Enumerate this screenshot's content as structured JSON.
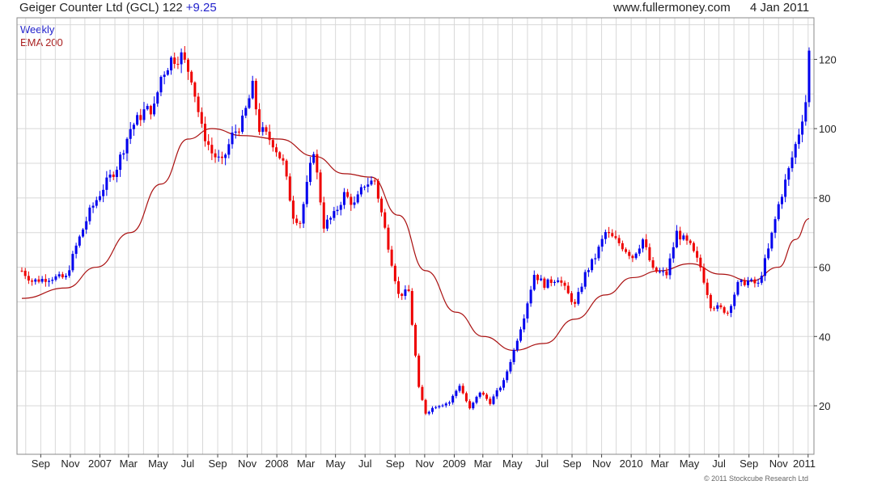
{
  "header": {
    "instrument": "Geiger Counter Ltd (GCL)",
    "last_price": "122",
    "change": "+9.25",
    "site": "www.fullermoney.com",
    "date": "4 Jan 2011"
  },
  "legend": {
    "period": "Weekly",
    "indicator": "EMA 200"
  },
  "footer": {
    "copyright": "© 2011 Stockcube Research Ltd"
  },
  "colors": {
    "up": "#0000ee",
    "down": "#ee0000",
    "ema": "#aa1111",
    "grid": "#d8d8d8",
    "frame": "#888888"
  },
  "chart_data": {
    "type": "line",
    "subtype": "weekly candlestick price bars with moving average overlay",
    "x_label_format": "months and years",
    "x_tick_labels": [
      "Sep",
      "Nov",
      "2007",
      "Mar",
      "May",
      "Jul",
      "Sep",
      "Nov",
      "2008",
      "Mar",
      "May",
      "Jul",
      "Sep",
      "Nov",
      "2009",
      "Mar",
      "May",
      "Jul",
      "Sep",
      "Nov",
      "2010",
      "Mar",
      "May",
      "Jul",
      "Sep",
      "Nov",
      "2011"
    ],
    "x_range": [
      "2006-07-24",
      "2011-01-03"
    ],
    "y_ticks": [
      20,
      40,
      60,
      80,
      100,
      120
    ],
    "ylim": [
      6,
      132
    ],
    "y_axis_side": "right",
    "grid": true,
    "legend_position": "top-left",
    "series": [
      {
        "name": "Weekly",
        "style": "bars colored blue when up, red when down",
        "anchor_points": [
          [
            "2006-07-24",
            59
          ],
          [
            "2006-08-14",
            56
          ],
          [
            "2006-09-25",
            57
          ],
          [
            "2006-10-23",
            57
          ],
          [
            "2006-11-13",
            66
          ],
          [
            "2006-12-11",
            76
          ],
          [
            "2007-01-08",
            83
          ],
          [
            "2007-02-05",
            89
          ],
          [
            "2007-03-05",
            100
          ],
          [
            "2007-04-02",
            105
          ],
          [
            "2007-04-23",
            106
          ],
          [
            "2007-05-07",
            115
          ],
          [
            "2007-05-28",
            120
          ],
          [
            "2007-06-18",
            121
          ],
          [
            "2007-07-09",
            115
          ],
          [
            "2007-07-30",
            100
          ],
          [
            "2007-08-20",
            93
          ],
          [
            "2007-09-10",
            90
          ],
          [
            "2007-10-01",
            98
          ],
          [
            "2007-10-22",
            102
          ],
          [
            "2007-11-12",
            112
          ],
          [
            "2007-11-26",
            100
          ],
          [
            "2007-12-24",
            96
          ],
          [
            "2008-01-14",
            90
          ],
          [
            "2008-02-04",
            75
          ],
          [
            "2008-02-18",
            73
          ],
          [
            "2008-03-17",
            94
          ],
          [
            "2008-04-07",
            72
          ],
          [
            "2008-04-28",
            75
          ],
          [
            "2008-05-19",
            81
          ],
          [
            "2008-06-09",
            78
          ],
          [
            "2008-06-30",
            84
          ],
          [
            "2008-07-21",
            85
          ],
          [
            "2008-08-11",
            71
          ],
          [
            "2008-09-08",
            52
          ],
          [
            "2008-09-29",
            53
          ],
          [
            "2008-10-20",
            25
          ],
          [
            "2008-11-03",
            18
          ],
          [
            "2008-11-24",
            20
          ],
          [
            "2008-12-22",
            21
          ],
          [
            "2009-01-12",
            26
          ],
          [
            "2009-02-02",
            19
          ],
          [
            "2009-02-23",
            24
          ],
          [
            "2009-03-16",
            21
          ],
          [
            "2009-04-13",
            27
          ],
          [
            "2009-05-04",
            36
          ],
          [
            "2009-05-25",
            46
          ],
          [
            "2009-06-15",
            58
          ],
          [
            "2009-07-06",
            55
          ],
          [
            "2009-08-03",
            57
          ],
          [
            "2009-09-07",
            49
          ],
          [
            "2009-09-28",
            58
          ],
          [
            "2009-10-19",
            63
          ],
          [
            "2009-11-09",
            70
          ],
          [
            "2009-12-07",
            67
          ],
          [
            "2010-01-04",
            63
          ],
          [
            "2010-01-25",
            68
          ],
          [
            "2010-02-15",
            59
          ],
          [
            "2010-03-15",
            58
          ],
          [
            "2010-04-05",
            70
          ],
          [
            "2010-05-03",
            66
          ],
          [
            "2010-05-24",
            60
          ],
          [
            "2010-06-14",
            49
          ],
          [
            "2010-07-05",
            48
          ],
          [
            "2010-07-19",
            47
          ],
          [
            "2010-08-09",
            55
          ],
          [
            "2010-08-30",
            56
          ],
          [
            "2010-09-20",
            55
          ],
          [
            "2010-10-11",
            65
          ],
          [
            "2010-11-01",
            78
          ],
          [
            "2010-11-22",
            88
          ],
          [
            "2010-12-13",
            99
          ],
          [
            "2010-12-27",
            108
          ],
          [
            "2011-01-03",
            122
          ]
        ]
      },
      {
        "name": "EMA 200",
        "style": "line",
        "points": [
          [
            "2006-07-24",
            51
          ],
          [
            "2006-10-23",
            54
          ],
          [
            "2006-12-25",
            60
          ],
          [
            "2007-03-05",
            70
          ],
          [
            "2007-05-07",
            84
          ],
          [
            "2007-07-02",
            97
          ],
          [
            "2007-08-20",
            100
          ],
          [
            "2007-10-22",
            98
          ],
          [
            "2008-01-07",
            97
          ],
          [
            "2008-03-19",
            92
          ],
          [
            "2008-05-19",
            87
          ],
          [
            "2008-07-14",
            86
          ],
          [
            "2008-09-08",
            75
          ],
          [
            "2008-11-03",
            59
          ],
          [
            "2009-01-05",
            47
          ],
          [
            "2009-03-02",
            40
          ],
          [
            "2009-05-04",
            36
          ],
          [
            "2009-07-06",
            38
          ],
          [
            "2009-09-07",
            45
          ],
          [
            "2009-11-09",
            52
          ],
          [
            "2010-01-04",
            57
          ],
          [
            "2010-03-01",
            59
          ],
          [
            "2010-05-03",
            61
          ],
          [
            "2010-07-05",
            58
          ],
          [
            "2010-09-06",
            56
          ],
          [
            "2010-11-01",
            60
          ],
          [
            "2010-12-06",
            68
          ],
          [
            "2011-01-03",
            74
          ]
        ]
      }
    ]
  }
}
